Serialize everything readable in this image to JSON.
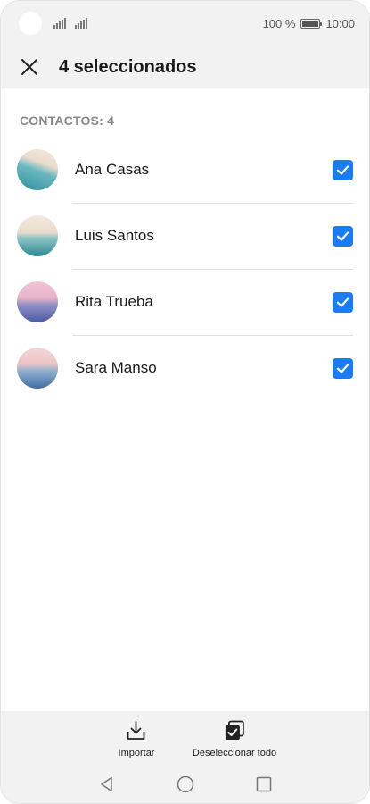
{
  "status_bar": {
    "battery_text": "100 %",
    "time": "10:00",
    "battery_level": 1.0
  },
  "header": {
    "title": "4 seleccionados",
    "close_icon": "close-icon"
  },
  "section": {
    "label": "CONTACTOS: 4"
  },
  "contacts": [
    {
      "name": "Ana Casas",
      "checked": true
    },
    {
      "name": "Luis Santos",
      "checked": true
    },
    {
      "name": "Rita Trueba",
      "checked": true
    },
    {
      "name": "Sara Manso",
      "checked": true
    }
  ],
  "actions": {
    "import_label": "Importar",
    "deselect_label": "Deseleccionar todo"
  },
  "colors": {
    "accent": "#1a7cf2",
    "bar_background": "#f2f2f2"
  }
}
